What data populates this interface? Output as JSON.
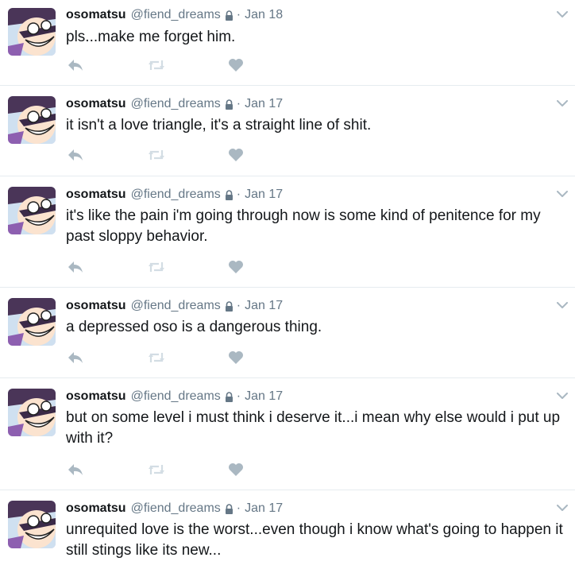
{
  "tweets": [
    {
      "name": "osomatsu",
      "handle": "@fiend_dreams",
      "date": "Jan 18",
      "text": "pls...make me forget him."
    },
    {
      "name": "osomatsu",
      "handle": "@fiend_dreams",
      "date": "Jan 17",
      "text": "it isn't a love triangle, it's a straight line of shit."
    },
    {
      "name": "osomatsu",
      "handle": "@fiend_dreams",
      "date": "Jan 17",
      "text": "it's like the pain i'm going through now is some kind of penitence for my past sloppy behavior."
    },
    {
      "name": "osomatsu",
      "handle": "@fiend_dreams",
      "date": "Jan 17",
      "text": "a depressed oso is a dangerous thing."
    },
    {
      "name": "osomatsu",
      "handle": "@fiend_dreams",
      "date": "Jan 17",
      "text": "but on some level i must think i deserve it...i mean why else would i put up with it?"
    },
    {
      "name": "osomatsu",
      "handle": "@fiend_dreams",
      "date": "Jan 17",
      "text": "unrequited love is the worst...even though i know what's going to happen it still stings like its new..."
    }
  ],
  "separator": "·",
  "icons": {
    "lock": "lock-icon",
    "reply": "reply-icon",
    "retweet": "retweet-icon",
    "like": "heart-icon",
    "more": "chevron-down-icon"
  },
  "colors": {
    "name": "#14171a",
    "meta": "#657786",
    "action": "#aab8c2",
    "border": "#e6ecf0"
  }
}
